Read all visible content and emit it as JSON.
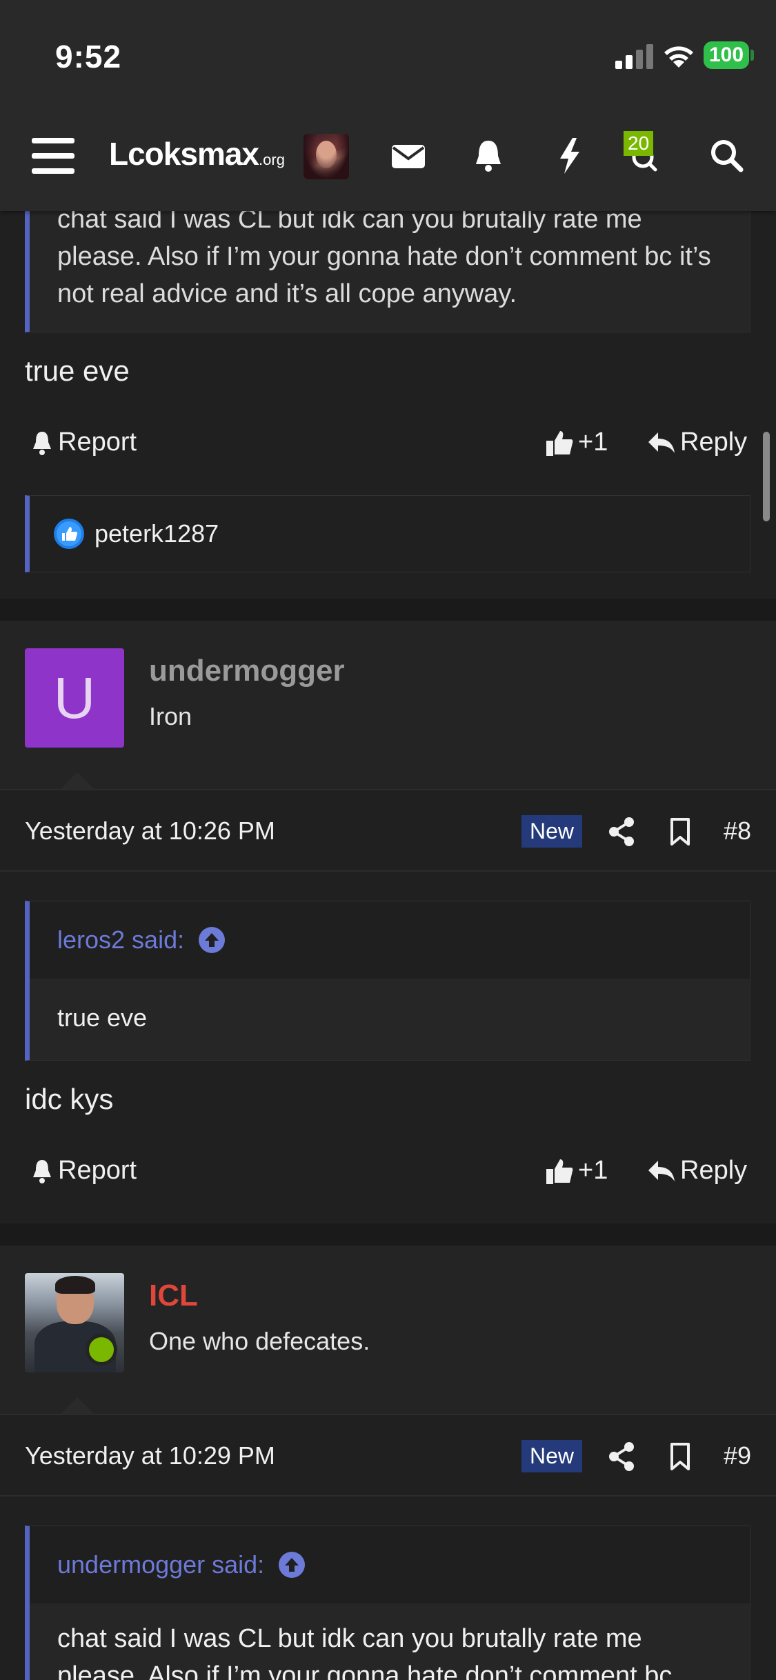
{
  "status_bar": {
    "time": "9:52",
    "battery": "100"
  },
  "nav": {
    "logo_main": "Lcoksmax",
    "logo_suffix": ".org",
    "notification_count": "20"
  },
  "previous_post": {
    "quote_text": "chat said I was CL but idk can you brutally rate me please. Also if I’m your gonna hate don’t comment bc it’s not real advice and it’s all cope anyway.",
    "body": "true eve",
    "report_label": "Report",
    "like_label": "+1",
    "reply_label": "Reply",
    "reaction_user": "peterk1287"
  },
  "posts": [
    {
      "avatar_letter": "U",
      "username": "undermogger",
      "user_title": "Iron",
      "username_color": "#9a9a9a",
      "date": "Yesterday at 10:26 PM",
      "new_label": "New",
      "post_number": "#8",
      "quote_author": "leros2 said:",
      "quote_body": "true eve",
      "body": "idc kys",
      "report_label": "Report",
      "like_label": "+1",
      "reply_label": "Reply"
    },
    {
      "username": "ICL",
      "user_title": "One who defecates.",
      "username_color": "#e0463a",
      "date": "Yesterday at 10:29 PM",
      "new_label": "New",
      "post_number": "#9",
      "quote_author": "undermogger said:",
      "quote_body": "chat said I was CL but idk can you brutally rate me please. Also if I’m your gonna hate don’t comment bc"
    }
  ],
  "colors": {
    "accent": "#5563c1",
    "online": "#7ab800",
    "new_badge": "#243a7a"
  }
}
